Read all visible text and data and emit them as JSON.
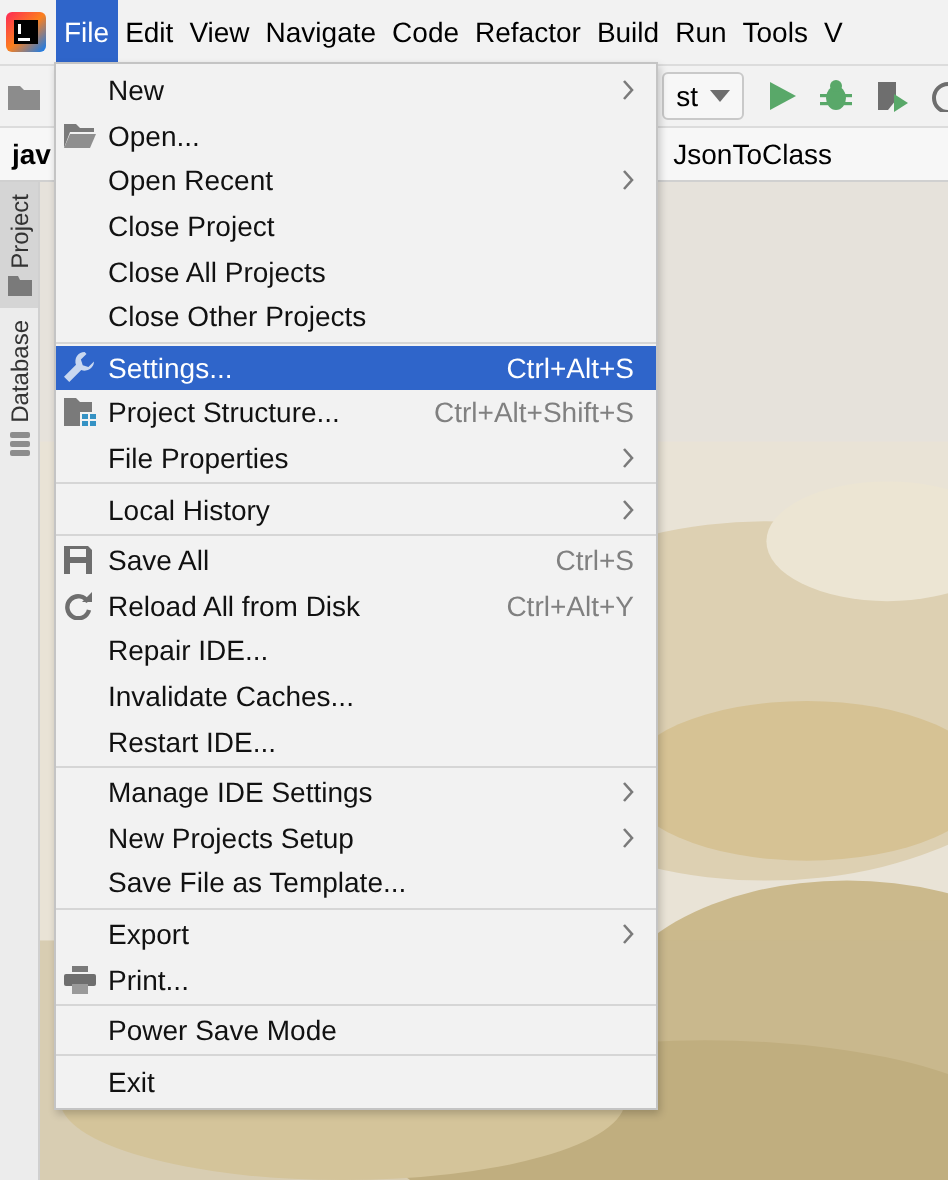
{
  "menu_bar": [
    {
      "label": "File",
      "selected": true
    },
    {
      "label": "Edit",
      "selected": false
    },
    {
      "label": "View",
      "selected": false
    },
    {
      "label": "Navigate",
      "selected": false
    },
    {
      "label": "Code",
      "selected": false
    },
    {
      "label": "Refactor",
      "selected": false
    },
    {
      "label": "Build",
      "selected": false
    },
    {
      "label": "Run",
      "selected": false
    },
    {
      "label": "Tools",
      "selected": false
    },
    {
      "label": "V",
      "selected": false
    }
  ],
  "toolbar": {
    "run_config": "st"
  },
  "tabs": [
    {
      "label": "jav"
    },
    {
      "label": "JsonToClass"
    }
  ],
  "side_tools": [
    "Project",
    "Database"
  ],
  "file_menu": [
    [
      {
        "label": "New",
        "submenu": true,
        "selected": false
      },
      {
        "label": "Open...",
        "submenu": false,
        "selected": false
      },
      {
        "label": "Open Recent",
        "submenu": true,
        "selected": false
      },
      {
        "label": "Close Project",
        "submenu": false,
        "selected": false
      },
      {
        "label": "Close All Projects",
        "submenu": false,
        "selected": false
      },
      {
        "label": "Close Other Projects",
        "submenu": false,
        "selected": false
      }
    ],
    [
      {
        "label": "Settings...",
        "shortcut": "Ctrl+Alt+S",
        "submenu": false,
        "selected": true
      },
      {
        "label": "Project Structure...",
        "shortcut": "Ctrl+Alt+Shift+S",
        "submenu": false,
        "selected": false
      },
      {
        "label": "File Properties",
        "submenu": true,
        "selected": false
      }
    ],
    [
      {
        "label": "Local History",
        "submenu": true,
        "selected": false
      }
    ],
    [
      {
        "label": "Save All",
        "shortcut": "Ctrl+S",
        "submenu": false,
        "selected": false
      },
      {
        "label": "Reload All from Disk",
        "shortcut": "Ctrl+Alt+Y",
        "submenu": false,
        "selected": false
      },
      {
        "label": "Repair IDE...",
        "submenu": false,
        "selected": false
      },
      {
        "label": "Invalidate Caches...",
        "submenu": false,
        "selected": false
      },
      {
        "label": "Restart IDE...",
        "submenu": false,
        "selected": false
      }
    ],
    [
      {
        "label": "Manage IDE Settings",
        "submenu": true,
        "selected": false
      },
      {
        "label": "New Projects Setup",
        "submenu": true,
        "selected": false
      },
      {
        "label": "Save File as Template...",
        "submenu": false,
        "selected": false
      }
    ],
    [
      {
        "label": "Export",
        "submenu": true,
        "selected": false
      },
      {
        "label": "Print...",
        "submenu": false,
        "selected": false
      }
    ],
    [
      {
        "label": "Power Save Mode",
        "submenu": false,
        "selected": false
      }
    ],
    [
      {
        "label": "Exit",
        "submenu": false,
        "selected": false
      }
    ]
  ]
}
